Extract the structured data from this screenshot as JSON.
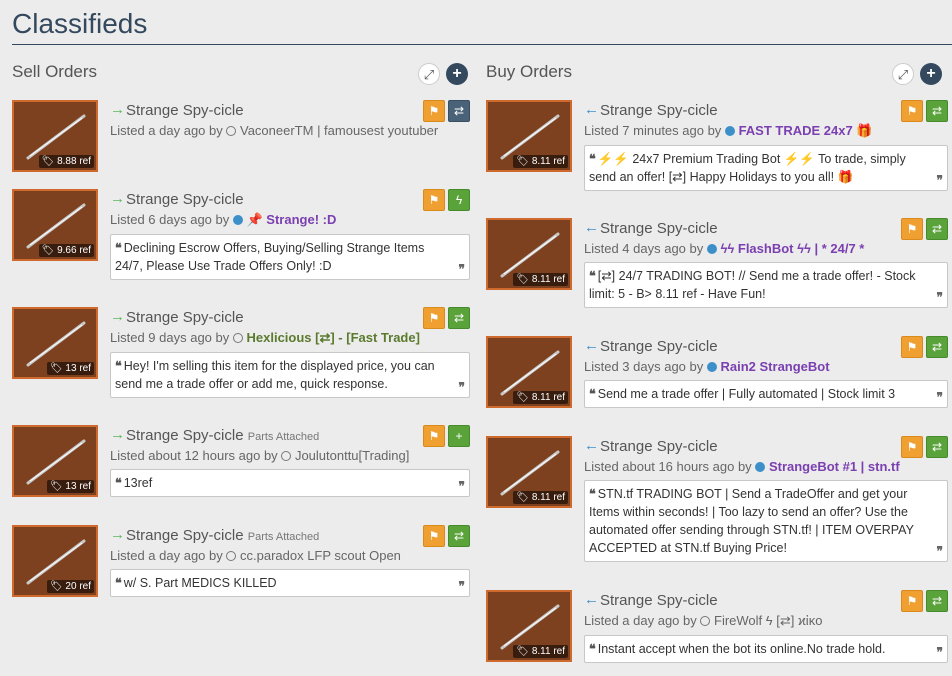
{
  "page": {
    "title": "Classifieds"
  },
  "sell": {
    "title": "Sell Orders",
    "listings": [
      {
        "item": "Strange Spy-cicle",
        "parts": "",
        "price": "8.88 ref",
        "listed": "Listed a day ago by",
        "user": "VaconeerTM | famousest youtuber",
        "online": false,
        "details": ""
      },
      {
        "item": "Strange Spy-cicle",
        "parts": "",
        "price": "9.66 ref",
        "listed": "Listed 6 days ago by",
        "user": "📌 Strange! :D",
        "online": true,
        "details": "Declining Escrow Offers, Buying/Selling Strange Items 24/7, Please Use Trade Offers Only! :D"
      },
      {
        "item": "Strange Spy-cicle",
        "parts": "",
        "price": "13 ref",
        "listed": "Listed 9 days ago by",
        "user": "Hexlicious [⇄] - [Fast Trade]",
        "online": false,
        "details": "Hey! I'm selling this item for the displayed price, you can send me a trade offer or add me, quick response."
      },
      {
        "item": "Strange Spy-cicle",
        "parts": "Parts Attached",
        "price": "13 ref",
        "listed": "Listed about 12 hours ago by",
        "user": "Joulutonttu[Trading]",
        "online": false,
        "details": "13ref"
      },
      {
        "item": "Strange Spy-cicle",
        "parts": "Parts Attached",
        "price": "20 ref",
        "listed": "Listed a day ago by",
        "user": "cc.paradox LFP scout Open",
        "online": false,
        "details": "w/ S. Part MEDICS KILLED"
      }
    ]
  },
  "buy": {
    "title": "Buy Orders",
    "listings": [
      {
        "item": "Strange Spy-cicle",
        "price": "8.11 ref",
        "listed": "Listed 7 minutes ago by",
        "user": "FAST TRADE 24x7 🎁",
        "online": true,
        "details": "⚡⚡ 24x7 Premium Trading Bot ⚡⚡ To trade, simply send an offer! [⇄] Happy Holidays to you all! 🎁"
      },
      {
        "item": "Strange Spy-cicle",
        "price": "8.11 ref",
        "listed": "Listed 4 days ago by",
        "user": "ϟϟ FlashBot ϟϟ | * 24/7 *",
        "online": true,
        "details": "[⇄] 24/7 TRADING BOT! // Send me a trade offer! - Stock limit: 5 - B> 8.11 ref - Have Fun!"
      },
      {
        "item": "Strange Spy-cicle",
        "price": "8.11 ref",
        "listed": "Listed 3 days ago by",
        "user": "Rain2 StrangeBot",
        "online": true,
        "details": "Send me a trade offer | Fully automated | Stock limit 3"
      },
      {
        "item": "Strange Spy-cicle",
        "price": "8.11 ref",
        "listed": "Listed about 16 hours ago by",
        "user": "StrangeBot #1 | stn.tf",
        "online": true,
        "details": "STN.tf TRADING BOT | Send a TradeOffer and get your Items within seconds! | Too lazy to send an offer? Use the automated offer sending through STN.tf! | ITEM OVERPAY ACCEPTED at STN.tf Buying Price!"
      },
      {
        "item": "Strange Spy-cicle",
        "price": "8.11 ref",
        "listed": "Listed a day ago by",
        "user": "FireWolf ϟ [⇄] ϰἰκo",
        "online": false,
        "details": "Instant accept when the bot its online.No trade hold."
      }
    ]
  },
  "icons": {
    "sell_arrow": "→",
    "buy_arrow": "←",
    "flag": "⚑",
    "trade": "⇄",
    "message": "⇄",
    "lightning": "ϟ",
    "add": "+",
    "expand": "⤢",
    "quote_open": "❝",
    "quote_close": "❞",
    "tag": "🏷"
  },
  "colors": {
    "title": "#34495e",
    "flag": "#f0a030",
    "trade": "#5aa23a",
    "pro_user": "#7a3fb0",
    "item_border": "#cf6a2e"
  }
}
